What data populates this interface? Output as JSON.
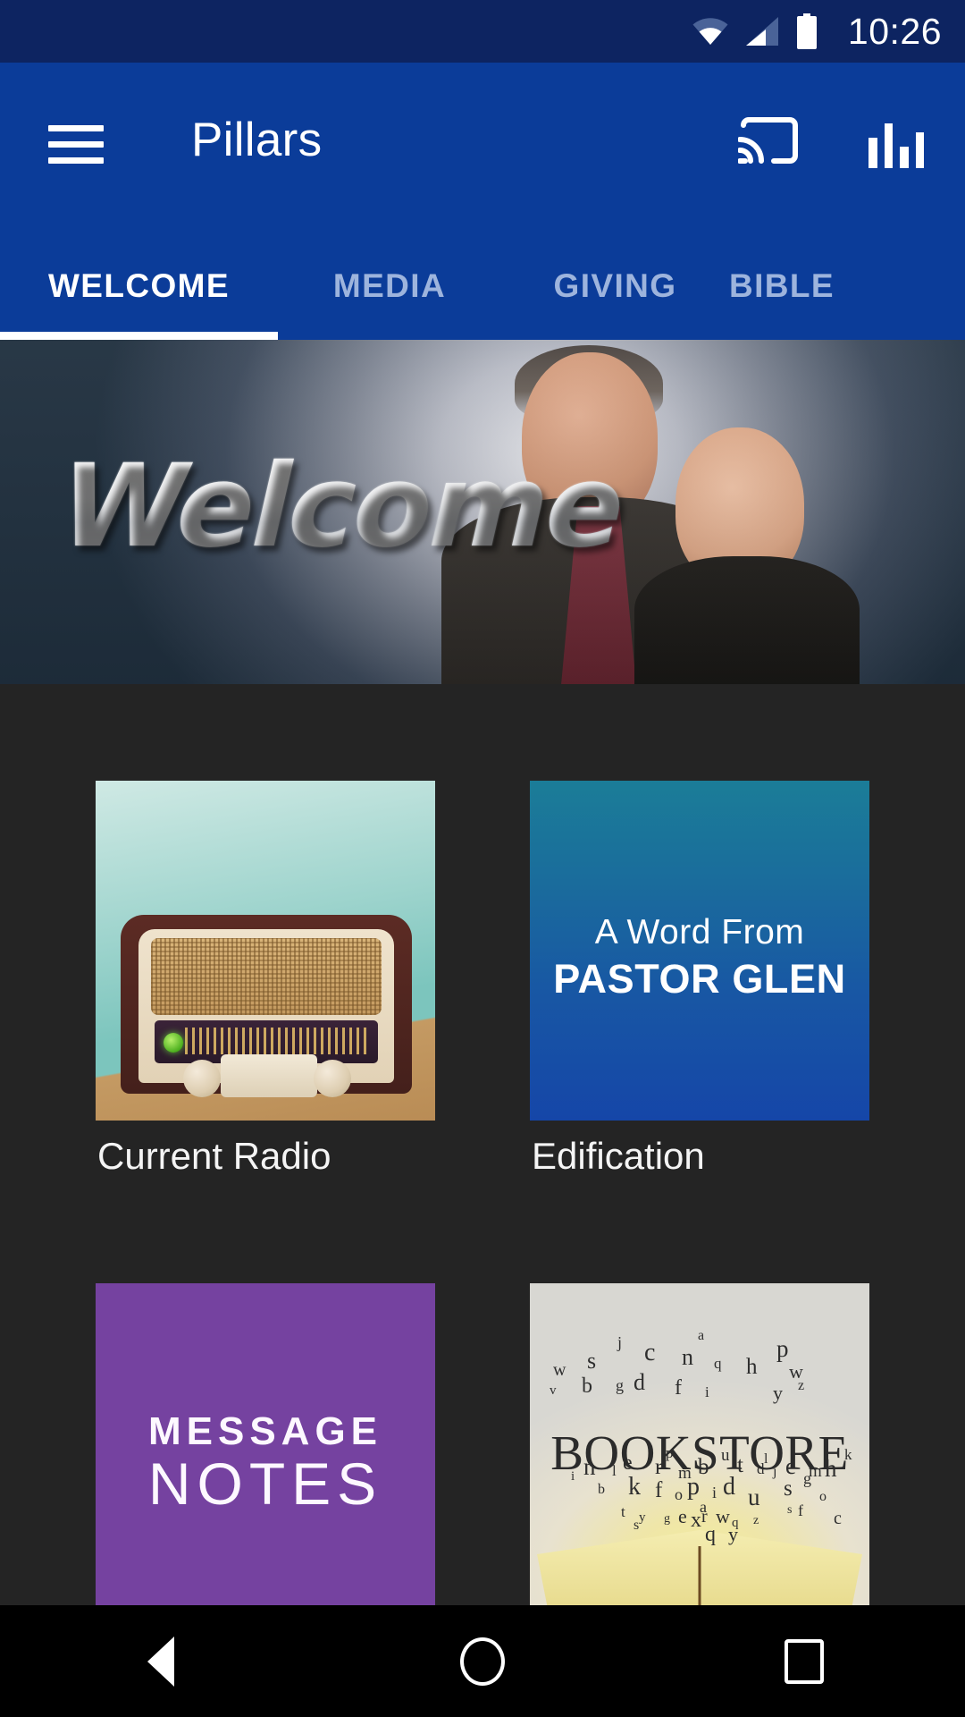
{
  "status_bar": {
    "time": "10:26",
    "icons": [
      "wifi-icon",
      "cellular-signal-icon",
      "battery-icon"
    ],
    "background_color": "#0d2461"
  },
  "app_bar": {
    "menu_icon": "hamburger-menu-icon",
    "title": "Pillars",
    "actions": [
      {
        "icon": "cast-icon",
        "label": "Cast"
      },
      {
        "icon": "equalizer-icon",
        "label": "Equalizer"
      }
    ],
    "background_color": "#0b3c99"
  },
  "tabs": {
    "items": [
      {
        "label": "WELCOME",
        "active": true
      },
      {
        "label": "MEDIA",
        "active": false
      },
      {
        "label": "GIVING",
        "active": false
      },
      {
        "label": "BIBLE",
        "active": false
      }
    ],
    "active_color": "#ffffff",
    "inactive_color": "#9db4dd"
  },
  "hero": {
    "headline": "Welcome",
    "alt": "Pastor couple smiling in front of a gradient backdrop"
  },
  "content": {
    "background_color": "#242424",
    "tiles": [
      {
        "label": "Current Radio",
        "image": "vintage-radio-photo",
        "image_text": ""
      },
      {
        "label": "Edification",
        "image": "pastor-glen-card",
        "image_text": {
          "line1": "A Word From",
          "line2": "PASTOR GLEN"
        },
        "accent_color": "#1857a4"
      },
      {
        "label": "",
        "image": "message-notes-card",
        "image_text": {
          "line1": "MESSAGE",
          "line2": "NOTES"
        },
        "accent_color": "#7542a0"
      },
      {
        "label": "",
        "image": "bookstore-photo",
        "image_text": {
          "line1": "BOOKSTORE"
        }
      }
    ]
  },
  "nav_bar": {
    "buttons": [
      {
        "icon": "back-triangle-icon",
        "label": "Back"
      },
      {
        "icon": "home-circle-icon",
        "label": "Home"
      },
      {
        "icon": "recents-square-icon",
        "label": "Recents"
      }
    ],
    "background_color": "#000000"
  }
}
